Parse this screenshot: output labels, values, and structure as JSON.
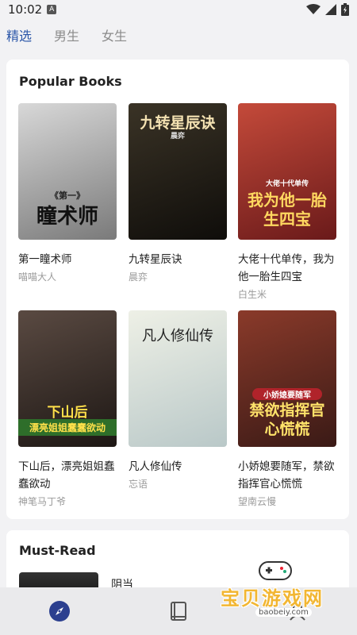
{
  "status_bar": {
    "time": "10:02",
    "notification_badge": "A"
  },
  "tabs": [
    {
      "label": "精选",
      "active": true
    },
    {
      "label": "男生",
      "active": false
    },
    {
      "label": "女生",
      "active": false
    }
  ],
  "popular": {
    "title": "Popular Books",
    "books": [
      {
        "title": "第一瞳术师",
        "author": "喵喵大人",
        "cover_text": "瞳术师",
        "cover_sub": "《第一》",
        "cover_colors": [
          "#d8d8d8",
          "#7a7a7a"
        ]
      },
      {
        "title": "九转星辰诀",
        "author": "晨弈",
        "cover_text": "九转星辰诀",
        "cover_sub": "晨弈",
        "cover_colors": [
          "#3a3326",
          "#0f0d0a"
        ]
      },
      {
        "title": "大佬十代单传，我为他一胎生四宝",
        "author": "白生米",
        "cover_text": "我为他一胎生四宝",
        "cover_sub": "大佬十代单传",
        "cover_colors": [
          "#c44a3a",
          "#6a1a1a"
        ]
      },
      {
        "title": "下山后，漂亮姐姐蠢蠢欲动",
        "author": "神笔马丁爷",
        "cover_text": "漂亮姐姐蠢蠢欲动",
        "cover_sub": "下山后",
        "cover_colors": [
          "#5a4a42",
          "#1d1714"
        ]
      },
      {
        "title": "凡人修仙传",
        "author": "忘语",
        "cover_text": "凡人修仙传",
        "cover_sub": "",
        "cover_colors": [
          "#eef0e6",
          "#b9c8c8"
        ]
      },
      {
        "title": "小娇媳要随军，禁欲指挥官心慌慌",
        "author": "望南云慢",
        "cover_text": "禁欲指挥官心慌慌",
        "cover_sub": "小娇媳要随军",
        "cover_colors": [
          "#8a3a2a",
          "#3a1a16"
        ]
      }
    ]
  },
  "must_read": {
    "title": "Must-Read",
    "first_item_title": "阴当"
  },
  "bottom_nav": [
    {
      "icon": "compass-icon",
      "active": true
    },
    {
      "icon": "book-icon",
      "active": false
    }
  ],
  "watermark": {
    "text": "宝贝游戏网",
    "url": "baobeiy.com"
  },
  "colors": {
    "accent": "#2b56a8",
    "background": "#f2f2f4",
    "card": "#ffffff"
  }
}
